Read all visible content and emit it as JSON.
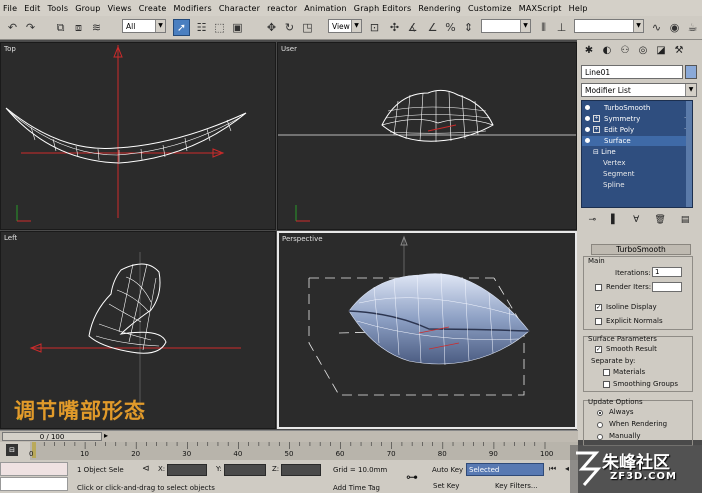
{
  "menu": [
    "File",
    "Edit",
    "Tools",
    "Group",
    "Views",
    "Create",
    "Modifiers",
    "Character",
    "reactor",
    "Animation",
    "Graph Editors",
    "Rendering",
    "Customize",
    "MAXScript",
    "Help"
  ],
  "toolbar": {
    "selection_filter": "All",
    "ref_coord": "View"
  },
  "viewports": {
    "top": "Top",
    "user": "User",
    "left": "Left",
    "perspective": "Perspective"
  },
  "caption": "调节嘴部形态",
  "command_panel": {
    "object_name": "Line01",
    "object_color": "#8aa9d8",
    "modifier_list": "Modifier List",
    "stack": {
      "modifiers": [
        "TurboSmooth",
        "Symmetry",
        "Edit Poly",
        "Surface"
      ],
      "base": "Line",
      "subobjects": [
        "Vertex",
        "Segment",
        "Spline"
      ]
    },
    "turbosmooth": {
      "title": "TurboSmooth",
      "main": "Main",
      "iterations_label": "Iterations:",
      "iterations_value": "1",
      "render_iters_label": "Render Iters:",
      "isoline_label": "Isoline Display",
      "explicit_normals_label": "Explicit Normals",
      "surface_params": "Surface Parameters",
      "smooth_result": "Smooth Result",
      "separate_by": "Separate by:",
      "materials": "Materials",
      "smoothing_groups": "Smoothing Groups",
      "update_options": "Update Options",
      "always": "Always",
      "when_rendering": "When Rendering",
      "manually": "Manually"
    }
  },
  "timeline": {
    "frame_counter": "0 / 100",
    "ticks": [
      "0",
      "10",
      "20",
      "30",
      "40",
      "50",
      "60",
      "70",
      "80",
      "90",
      "100"
    ]
  },
  "status": {
    "selection_info": "1 Object Sele",
    "prompt": "Click or click-and-drag to select objects",
    "x_label": "X:",
    "y_label": "Y:",
    "z_label": "Z:",
    "grid": "Grid = 10.0mm",
    "add_time_tag": "Add Time Tag",
    "auto_key": "Auto Key",
    "set_key": "Set Key",
    "selected": "Selected",
    "key_filters": "Key Filters..."
  },
  "watermark": {
    "logo_text": "朱峰社区",
    "url": "ZF3D.COM"
  },
  "colors": {
    "viewport_bg": "#2b2b2b",
    "ui_gray": "#cfcbc3",
    "stack_blue": "#2f4e7f",
    "caption": "#e19a2a",
    "wireframe": "#ffffff",
    "axis_red": "#cc2b2b"
  }
}
